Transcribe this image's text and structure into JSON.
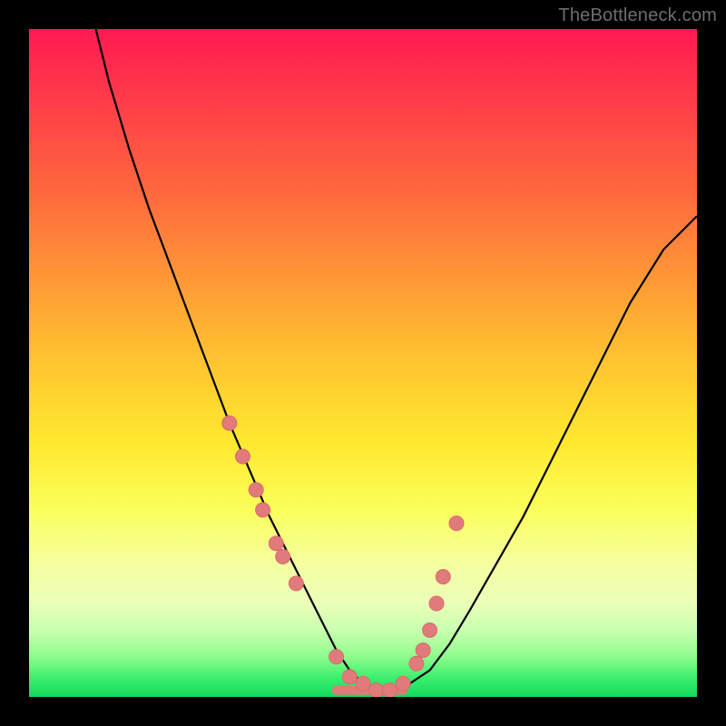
{
  "watermark": "TheBottleneck.com",
  "colors": {
    "curve_stroke": "#000000",
    "marker_fill": "#e17a7a",
    "marker_stroke": "#d86c6c",
    "frame": "#000000"
  },
  "chart_data": {
    "type": "line",
    "title": "",
    "xlabel": "",
    "ylabel": "",
    "x_range": [
      0,
      100
    ],
    "y_range": [
      0,
      100
    ],
    "note": "Axes are unlabeled; values are inferred from pixel positions on a 0–100 normalized range (x: left→right, y: bottom→top, so y≈0 is the green minimum and y≈100 is the red top).",
    "series": [
      {
        "name": "bottleneck-curve",
        "x": [
          10,
          12,
          15,
          18,
          21,
          24,
          27,
          30,
          33,
          36,
          39,
          42,
          44,
          46,
          48,
          50,
          52,
          54,
          57,
          60,
          63,
          66,
          70,
          74,
          78,
          82,
          86,
          90,
          95,
          100
        ],
        "y": [
          100,
          92,
          82,
          73,
          65,
          57,
          49,
          41,
          34,
          27,
          21,
          15,
          11,
          7,
          4,
          2,
          1,
          1,
          2,
          4,
          8,
          13,
          20,
          27,
          35,
          43,
          51,
          59,
          67,
          72
        ]
      }
    ],
    "markers": {
      "name": "highlighted-points",
      "x": [
        30,
        32,
        34,
        35,
        37,
        38,
        40,
        46,
        48,
        50,
        52,
        54,
        56,
        58,
        59,
        60,
        61,
        62,
        64
      ],
      "y": [
        41,
        36,
        31,
        28,
        23,
        21,
        17,
        6,
        3,
        2,
        1,
        1,
        2,
        5,
        7,
        10,
        14,
        18,
        26
      ]
    },
    "flat_segment": {
      "name": "minimum-plateau",
      "x": [
        46,
        56
      ],
      "y": [
        1,
        1
      ]
    }
  }
}
